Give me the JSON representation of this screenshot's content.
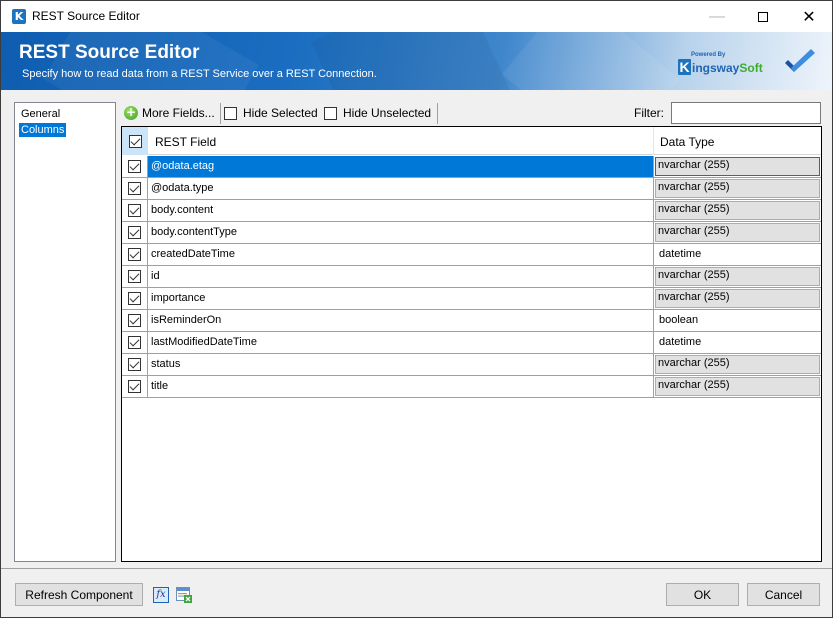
{
  "window": {
    "title": "REST Source Editor",
    "app_icon_letter": "K",
    "controls": {
      "minimize": "—",
      "close": "✕"
    }
  },
  "banner": {
    "title": "REST Source Editor",
    "subtitle": "Specify how to read data from a REST Service over a REST Connection.",
    "logo": {
      "powered_by": "Powered By",
      "letter": "K",
      "name_part1": "ingsway",
      "name_part2": "Soft"
    }
  },
  "nav": {
    "items": [
      {
        "label": "General",
        "selected": false
      },
      {
        "label": "Columns",
        "selected": true
      }
    ]
  },
  "toolbar": {
    "more_fields_label": "More Fields...",
    "hide_selected_label": "Hide Selected",
    "hide_selected_checked": false,
    "hide_unselected_label": "Hide Unselected",
    "hide_unselected_checked": false,
    "filter_label": "Filter:",
    "filter_value": ""
  },
  "grid": {
    "columns": [
      "REST Field",
      "Data Type"
    ],
    "header_checked": true,
    "rows": [
      {
        "field": "@odata.etag",
        "type": "nvarchar (255)",
        "checked": true,
        "combo": true,
        "selected": true
      },
      {
        "field": "@odata.type",
        "type": "nvarchar (255)",
        "checked": true,
        "combo": true,
        "selected": false
      },
      {
        "field": "body.content",
        "type": "nvarchar (255)",
        "checked": true,
        "combo": true,
        "selected": false
      },
      {
        "field": "body.contentType",
        "type": "nvarchar (255)",
        "checked": true,
        "combo": true,
        "selected": false
      },
      {
        "field": "createdDateTime",
        "type": "datetime",
        "checked": true,
        "combo": false,
        "selected": false
      },
      {
        "field": "id",
        "type": "nvarchar (255)",
        "checked": true,
        "combo": true,
        "selected": false
      },
      {
        "field": "importance",
        "type": "nvarchar (255)",
        "checked": true,
        "combo": true,
        "selected": false
      },
      {
        "field": "isReminderOn",
        "type": "boolean",
        "checked": true,
        "combo": false,
        "selected": false
      },
      {
        "field": "lastModifiedDateTime",
        "type": "datetime",
        "checked": true,
        "combo": false,
        "selected": false
      },
      {
        "field": "status",
        "type": "nvarchar (255)",
        "checked": true,
        "combo": true,
        "selected": false
      },
      {
        "field": "title",
        "type": "nvarchar (255)",
        "checked": true,
        "combo": true,
        "selected": false
      }
    ]
  },
  "footer": {
    "refresh_label": "Refresh Component",
    "fx_icon_text": "fx",
    "ok_label": "OK",
    "cancel_label": "Cancel"
  },
  "colors": {
    "accent": "#0078d7",
    "banner_blue": "#1a6dc0",
    "logo_green": "#3dae2b"
  }
}
